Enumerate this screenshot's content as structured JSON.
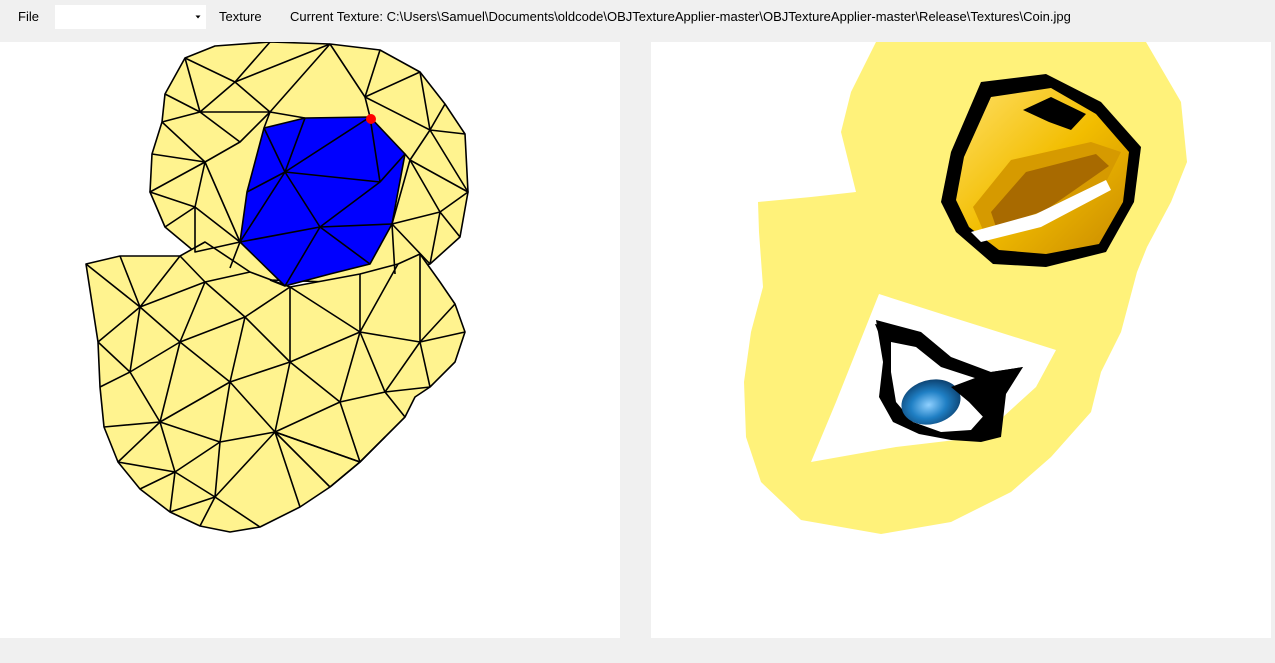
{
  "menu": {
    "file_label": "File",
    "texture_label": "Texture"
  },
  "object_select": {
    "value": ""
  },
  "status": {
    "current_texture": "Current Texture: C:\\Users\\Samuel\\Documents\\oldcode\\OBJTextureApplier-master\\OBJTextureApplier-master\\Release\\Textures\\Coin.jpg"
  },
  "icons": {
    "combo_arrow": "chevron-down-icon",
    "selected_vertex": "vertex-marker-icon"
  },
  "colors": {
    "mesh_fill": "#fff38f",
    "mesh_selected": "#0000ff",
    "mesh_edge": "#000000",
    "vertex_marker": "#ff0000",
    "uv_background": "#fff27a",
    "coin_gold": "#f5c400",
    "eye_blue": "#1f7fc4",
    "window_bg": "#f0f0f0",
    "viewport_bg": "#ffffff"
  }
}
